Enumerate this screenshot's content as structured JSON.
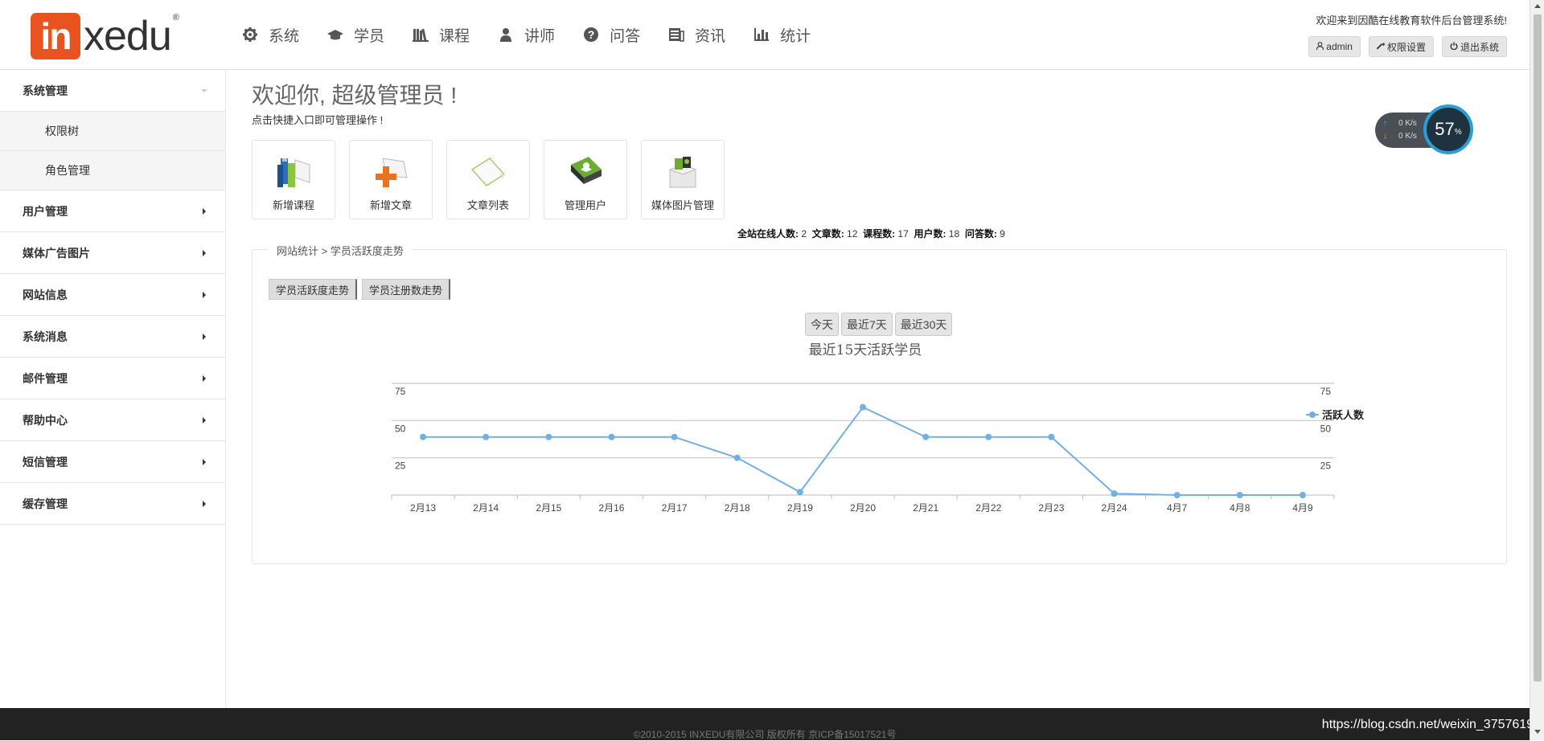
{
  "logo": {
    "box_text": "in",
    "rest_text": "xedu",
    "reg": "®"
  },
  "nav": [
    {
      "label": "系统",
      "icon": "gear-icon"
    },
    {
      "label": "学员",
      "icon": "graduation-cap-icon"
    },
    {
      "label": "课程",
      "icon": "books-icon"
    },
    {
      "label": "讲师",
      "icon": "user-icon"
    },
    {
      "label": "问答",
      "icon": "question-icon"
    },
    {
      "label": "资讯",
      "icon": "news-icon"
    },
    {
      "label": "统计",
      "icon": "bar-chart-icon"
    }
  ],
  "header": {
    "welcome": "欢迎来到因酷在线教育软件后台管理系统!",
    "admin_label": "admin",
    "perm_label": "权限设置",
    "logout_label": "退出系统"
  },
  "sidebar": {
    "system": "系统管理",
    "sub": [
      "权限树",
      "角色管理"
    ],
    "items": [
      "用户管理",
      "媒体广告图片",
      "网站信息",
      "系统消息",
      "邮件管理",
      "帮助中心",
      "短信管理",
      "缓存管理"
    ]
  },
  "main": {
    "title": "欢迎你, 超级管理员 !",
    "subtitle": "点击快捷入口即可管理操作 !",
    "quick": [
      "新增课程",
      "新增文章",
      "文章列表",
      "管理用户",
      "媒体图片管理"
    ],
    "stats": {
      "online_label": "全站在线人数:",
      "online": "2",
      "articles_label": "文章数:",
      "articles": "12",
      "courses_label": "课程数:",
      "courses": "17",
      "users_label": "用户数:",
      "users": "18",
      "qa_label": "问答数:",
      "qa": "9"
    },
    "gauge": {
      "up": "0 K/s",
      "down": "0 K/s",
      "percent": "57",
      "unit": "%"
    },
    "panel_legend": "网站统计 > 学员活跃度走势",
    "tabs": [
      "学员活跃度走势",
      "学员注册数走势"
    ],
    "ranges": [
      "今天",
      "最近7天",
      "最近30天"
    ]
  },
  "chart_data": {
    "type": "line",
    "title": "最近15天活跃学员",
    "categories": [
      "2月13",
      "2月14",
      "2月15",
      "2月16",
      "2月17",
      "2月18",
      "2月19",
      "2月20",
      "2月21",
      "2月22",
      "2月23",
      "2月24",
      "4月7",
      "4月8",
      "4月9"
    ],
    "series": [
      {
        "name": "活跃人数",
        "values": [
          39,
          39,
          39,
          39,
          39,
          25,
          2,
          59,
          39,
          39,
          39,
          1,
          0,
          0,
          0
        ]
      }
    ],
    "ylim": [
      0,
      75
    ],
    "yticks": [
      25,
      50,
      75
    ],
    "color": "#72b0e2",
    "grid": true,
    "legend": "right"
  },
  "footer": {
    "text": "©2010-2015 INXEDU有限公司 版权所有 京ICP备15017521号"
  },
  "watermark": "https://blog.csdn.net/weixin_37576193"
}
